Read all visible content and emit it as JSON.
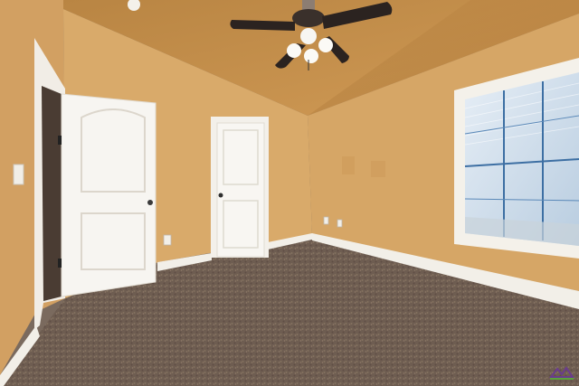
{
  "scene": {
    "description_free": true,
    "palette": {
      "left_wall": "#d6a463",
      "back_wall": "#d9a968",
      "right_wall": "#d5a465",
      "ceiling_left": "#c8944f",
      "ceiling_right": "#bf8a48",
      "carpet": "#6e5d51",
      "trim": "#f4f1ea",
      "door": "#f6f4ef",
      "fan_blade": "#2b2320",
      "window_glass": "#cfe0ef",
      "watermark_purple": "#6a3c8c",
      "watermark_green": "#5aa23c"
    }
  }
}
